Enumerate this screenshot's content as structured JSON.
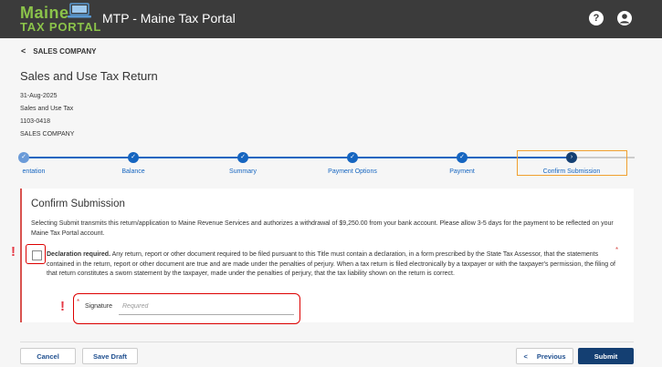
{
  "header": {
    "logo_line1": "Maine",
    "logo_line2": "TAX PORTAL",
    "app_title": "MTP - Maine Tax Portal",
    "help_icon": "?",
    "icons": [
      "laptop-icon",
      "help-icon",
      "user-account-icon"
    ],
    "bg_color": "#3b3b3b",
    "logo_color": "#8bc34a"
  },
  "breadcrumb": {
    "chevron": "<",
    "label": "SALES COMPANY"
  },
  "page": {
    "title": "Sales and Use Tax Return",
    "date": "31-Aug-2025",
    "tax_type": "Sales and Use Tax",
    "account_id": "1103-0418",
    "company": "SALES COMPANY"
  },
  "stepper": {
    "steps": [
      {
        "label": "entation",
        "state": "complete"
      },
      {
        "label": "Balance",
        "state": "complete"
      },
      {
        "label": "Summary",
        "state": "complete"
      },
      {
        "label": "Payment Options",
        "state": "complete"
      },
      {
        "label": "Payment",
        "state": "complete"
      },
      {
        "label": "Confirm Submission",
        "state": "current"
      }
    ],
    "accent_color": "#1565c0",
    "highlight_color": "#f0a030"
  },
  "confirm": {
    "title": "Confirm Submission",
    "text": "Selecting Submit transmits this return/application to Maine Revenue Services and authorizes a withdrawal of $9,250.00 from your bank account. Please allow 3-5 days for the payment to be reflected on your Maine Tax Portal account.",
    "declaration_heading": "Declaration required.",
    "declaration_body": " Any return, report or other document required to be filed pursuant to this Title must contain a declaration, in a form prescribed by the State Tax Assessor, that the statements contained in the return, report or other document are true and are made under the penalties of perjury.  When a tax return is filed electronically by a taxpayer or with the taxpayer's permission, the filing of that return constitutes a sworn statement by the taxpayer, made under the penalties of perjury, that the tax liability shown on the return is correct.",
    "required_star": "*",
    "alert_mark": "!",
    "signature_label": "Signature",
    "signature_placeholder": "Required",
    "signature_value": "",
    "error_color": "#d9534f"
  },
  "footer": {
    "cancel_label": "Cancel",
    "save_draft_label": "Save Draft",
    "previous_chevron": "<",
    "previous_label": "Previous",
    "submit_label": "Submit",
    "primary_color": "#143f72"
  }
}
